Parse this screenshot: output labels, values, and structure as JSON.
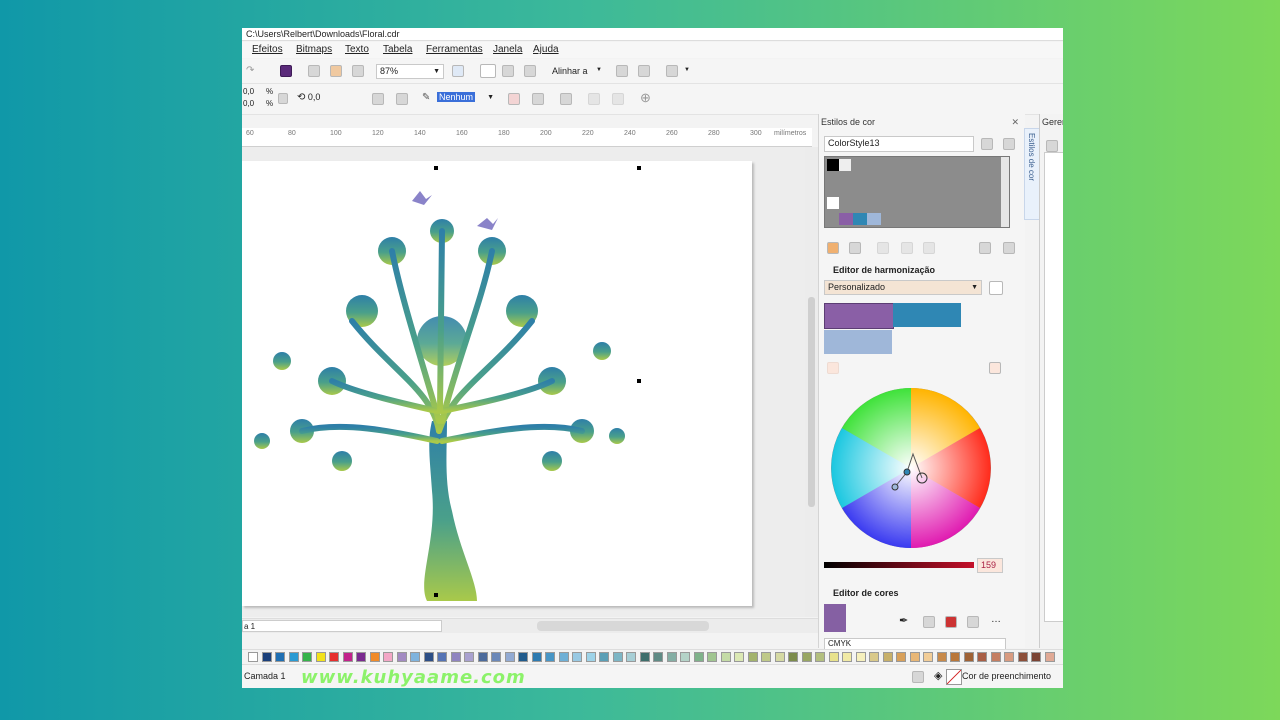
{
  "window": {
    "title": "C:\\Users\\Relbert\\Downloads\\Floral.cdr"
  },
  "menu": [
    {
      "label": "Efeitos"
    },
    {
      "label": "Bitmaps"
    },
    {
      "label": "Texto"
    },
    {
      "label": "Tabela"
    },
    {
      "label": "Ferramentas"
    },
    {
      "label": "Janela"
    },
    {
      "label": "Ajuda"
    }
  ],
  "toolbar": {
    "zoom_value": "87%",
    "align_label": "Alinhar a",
    "size_x": "0,0",
    "size_y": "0,0",
    "unit_x": "%",
    "unit_y": "%",
    "rotation_value": "0,0",
    "outline_value": "Nenhum"
  },
  "ruler": {
    "ticks": [
      "60",
      "80",
      "100",
      "120",
      "140",
      "160",
      "180",
      "200",
      "220",
      "240",
      "260",
      "280",
      "300"
    ],
    "unit": "milímetros"
  },
  "docker": {
    "title": "Estilos de cor",
    "style_name": "ColorStyle13",
    "vertical_tab": "Estilos de cor",
    "harmony_title": "Editor de harmonização",
    "harmony_rule": "Personalizado",
    "harmony_colors": [
      "#8a5fa6",
      "#2f87b4",
      "#9fb7d9"
    ],
    "slider_value": "159",
    "color_editor_title": "Editor de cores",
    "color_model": "CMYK",
    "current_color": "#8560a3"
  },
  "right_pane": {
    "title": "Geren"
  },
  "page": {
    "tab_label": "a 1"
  },
  "palette": {
    "colors": [
      "#ffffff",
      "#1a3f7a",
      "#1f6fb3",
      "#2a9bd3",
      "#35b34a",
      "#f2e21c",
      "#e62e2d",
      "#c2228b",
      "#7a2a8f",
      "#f08b2a",
      "#f3a7c6",
      "#a28ac2",
      "#7fb3dd",
      "#2c4e86",
      "#5573b5",
      "#8f84c0",
      "#a9a1cf",
      "#4c6b9c",
      "#6b88b8",
      "#93abd3",
      "#205b8c",
      "#2d7ab0",
      "#4896c6",
      "#6fb0d6",
      "#98c9e3",
      "#9ed3e8",
      "#5b9fb6",
      "#7db6c5",
      "#a7cfd6",
      "#3e6e6b",
      "#5f8b85",
      "#84aea4",
      "#b4d3c8",
      "#7fb28a",
      "#a0c590",
      "#c4dba6",
      "#dbe8b4",
      "#a3b36d",
      "#bfc989",
      "#d5d9a3",
      "#7c8c4c",
      "#98a663",
      "#b3bf7f",
      "#e8e28c",
      "#f1eaa5",
      "#f6f0bd",
      "#d9c98a",
      "#c7b06a",
      "#d8a05a",
      "#e8b777",
      "#f2cd97",
      "#c88a4a",
      "#b9773a",
      "#9f6235",
      "#a85e45",
      "#c47e62",
      "#d89b80",
      "#8c4f3a",
      "#7a4334",
      "#e0a995"
    ]
  },
  "status": {
    "layer": "Camada 1",
    "fill_label": "Cor de preenchimento"
  },
  "watermark": "www.kuhyaame.com",
  "accent_color": "#3a6fd9"
}
